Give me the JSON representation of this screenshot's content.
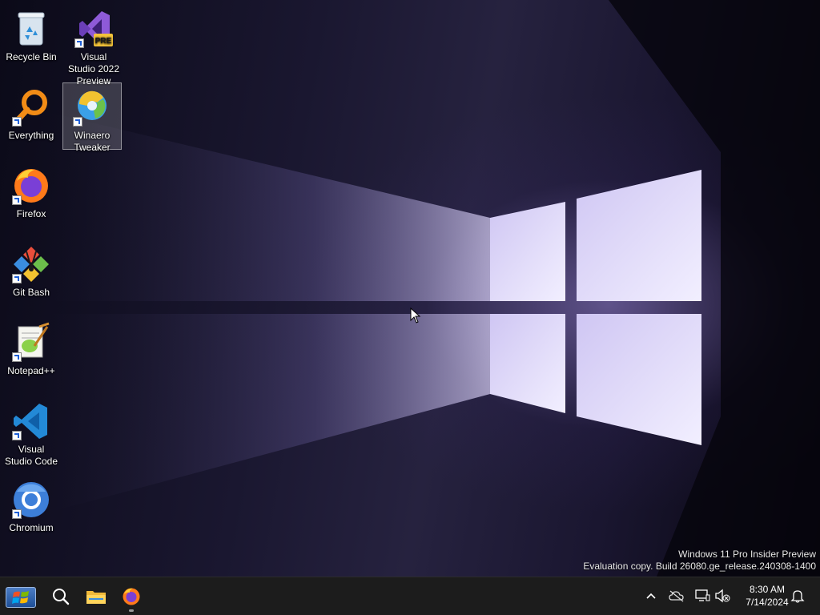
{
  "desktop": {
    "icons": [
      {
        "label": "Recycle Bin"
      },
      {
        "label": "Visual Studio 2022 Preview",
        "badge": "PRE"
      },
      {
        "label": "Everything"
      },
      {
        "label": "Winaero Tweaker",
        "selected": true
      },
      {
        "label": "Firefox"
      },
      {
        "label": "Git Bash"
      },
      {
        "label": "Notepad++"
      },
      {
        "label": "Visual Studio Code"
      },
      {
        "label": "Chromium"
      }
    ],
    "watermark": {
      "line1": "Windows 11 Pro Insider Preview",
      "line2": "Evaluation copy. Build 26080.ge_release.240308-1400"
    }
  },
  "taskbar": {
    "items": [
      {
        "icon": "windows-start-icon"
      },
      {
        "icon": "search-icon"
      },
      {
        "icon": "file-explorer-icon"
      },
      {
        "icon": "firefox-icon",
        "running": true
      }
    ],
    "tray": {
      "icons": [
        "chevron-up-icon",
        "onedrive-offline-icon",
        "network-icon",
        "volume-muted-icon",
        "notifications-bell-icon"
      ],
      "time": "8:30 AM",
      "date": "7/14/2024"
    }
  },
  "colors": {
    "accent_purple": "#8b6fd0",
    "taskbar_bg": "#1c1c1c",
    "light_window": "#e8e4fb"
  }
}
